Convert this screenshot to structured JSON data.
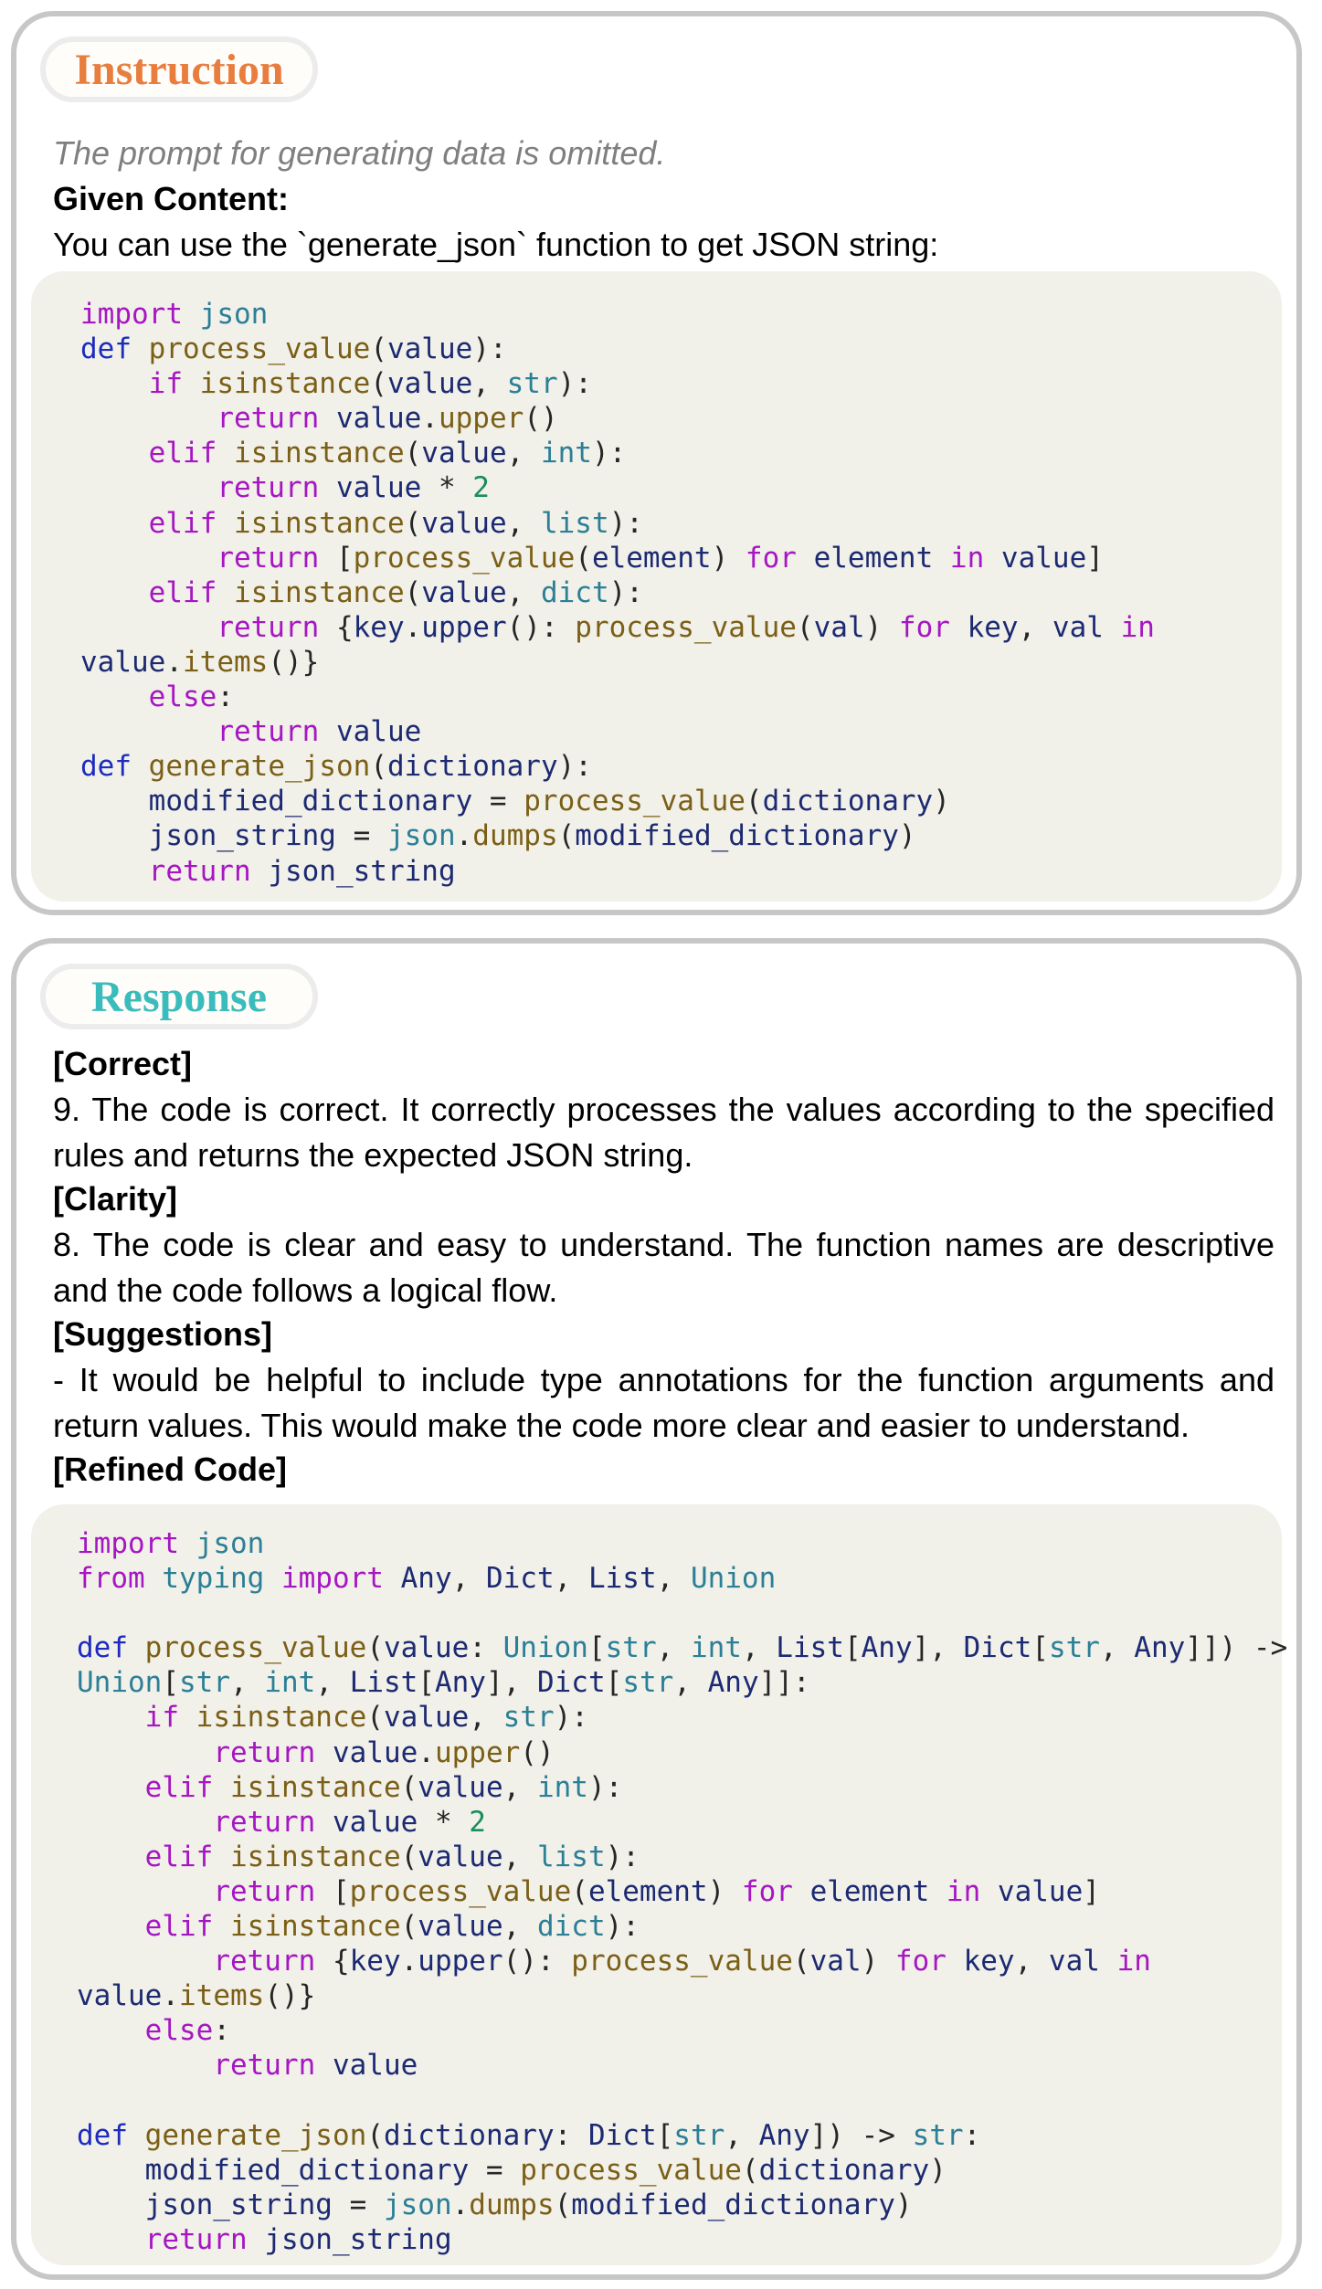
{
  "instruction": {
    "title": "Instruction",
    "note": "The prompt for generating data is omitted.",
    "given_label": "Given Content:",
    "given_text": "You can use the `generate_json` function to get JSON string:",
    "code": [
      [
        [
          "kw",
          "import"
        ],
        [
          "op",
          " "
        ],
        [
          "bi",
          "json"
        ]
      ],
      [
        [
          "kb",
          "def"
        ],
        [
          "op",
          " "
        ],
        [
          "fn",
          "process_value"
        ],
        [
          "op",
          "("
        ],
        [
          "id",
          "value"
        ],
        [
          "op",
          "):"
        ]
      ],
      [
        [
          "op",
          "    "
        ],
        [
          "kw",
          "if"
        ],
        [
          "op",
          " "
        ],
        [
          "fn",
          "isinstance"
        ],
        [
          "op",
          "("
        ],
        [
          "id",
          "value"
        ],
        [
          "op",
          ", "
        ],
        [
          "bi",
          "str"
        ],
        [
          "op",
          "):"
        ]
      ],
      [
        [
          "op",
          "        "
        ],
        [
          "kw",
          "return"
        ],
        [
          "op",
          " "
        ],
        [
          "id",
          "value"
        ],
        [
          "op",
          "."
        ],
        [
          "fn",
          "upper"
        ],
        [
          "op",
          "()"
        ]
      ],
      [
        [
          "op",
          "    "
        ],
        [
          "kw",
          "elif"
        ],
        [
          "op",
          " "
        ],
        [
          "fn",
          "isinstance"
        ],
        [
          "op",
          "("
        ],
        [
          "id",
          "value"
        ],
        [
          "op",
          ", "
        ],
        [
          "bi",
          "int"
        ],
        [
          "op",
          "):"
        ]
      ],
      [
        [
          "op",
          "        "
        ],
        [
          "kw",
          "return"
        ],
        [
          "op",
          " "
        ],
        [
          "id",
          "value"
        ],
        [
          "op",
          " * "
        ],
        [
          "nm",
          "2"
        ]
      ],
      [
        [
          "op",
          "    "
        ],
        [
          "kw",
          "elif"
        ],
        [
          "op",
          " "
        ],
        [
          "fn",
          "isinstance"
        ],
        [
          "op",
          "("
        ],
        [
          "id",
          "value"
        ],
        [
          "op",
          ", "
        ],
        [
          "bi",
          "list"
        ],
        [
          "op",
          "):"
        ]
      ],
      [
        [
          "op",
          "        "
        ],
        [
          "kw",
          "return"
        ],
        [
          "op",
          " ["
        ],
        [
          "fn",
          "process_value"
        ],
        [
          "op",
          "("
        ],
        [
          "id",
          "element"
        ],
        [
          "op",
          ") "
        ],
        [
          "kw",
          "for"
        ],
        [
          "op",
          " "
        ],
        [
          "id",
          "element"
        ],
        [
          "op",
          " "
        ],
        [
          "kw",
          "in"
        ],
        [
          "op",
          " "
        ],
        [
          "id",
          "value"
        ],
        [
          "op",
          "]"
        ]
      ],
      [
        [
          "op",
          "    "
        ],
        [
          "kw",
          "elif"
        ],
        [
          "op",
          " "
        ],
        [
          "fn",
          "isinstance"
        ],
        [
          "op",
          "("
        ],
        [
          "id",
          "value"
        ],
        [
          "op",
          ", "
        ],
        [
          "bi",
          "dict"
        ],
        [
          "op",
          "):"
        ]
      ],
      [
        [
          "op",
          "        "
        ],
        [
          "kw",
          "return"
        ],
        [
          "op",
          " {"
        ],
        [
          "id",
          "key"
        ],
        [
          "op",
          "."
        ],
        [
          "id",
          "upper"
        ],
        [
          "op",
          "(): "
        ],
        [
          "fn",
          "process_value"
        ],
        [
          "op",
          "("
        ],
        [
          "id",
          "val"
        ],
        [
          "op",
          ") "
        ],
        [
          "kw",
          "for"
        ],
        [
          "op",
          " "
        ],
        [
          "id",
          "key"
        ],
        [
          "op",
          ", "
        ],
        [
          "id",
          "val"
        ],
        [
          "op",
          " "
        ],
        [
          "kw",
          "in"
        ]
      ],
      [
        [
          "id",
          "value"
        ],
        [
          "op",
          "."
        ],
        [
          "fn",
          "items"
        ],
        [
          "op",
          "()}"
        ]
      ],
      [
        [
          "op",
          "    "
        ],
        [
          "kw",
          "else"
        ],
        [
          "op",
          ":"
        ]
      ],
      [
        [
          "op",
          "        "
        ],
        [
          "kw",
          "return"
        ],
        [
          "op",
          " "
        ],
        [
          "id",
          "value"
        ]
      ],
      [
        [
          "kb",
          "def"
        ],
        [
          "op",
          " "
        ],
        [
          "fn",
          "generate_json"
        ],
        [
          "op",
          "("
        ],
        [
          "id",
          "dictionary"
        ],
        [
          "op",
          "):"
        ]
      ],
      [
        [
          "op",
          "    "
        ],
        [
          "id",
          "modified_dictionary"
        ],
        [
          "op",
          " = "
        ],
        [
          "fn",
          "process_value"
        ],
        [
          "op",
          "("
        ],
        [
          "id",
          "dictionary"
        ],
        [
          "op",
          ")"
        ]
      ],
      [
        [
          "op",
          "    "
        ],
        [
          "id",
          "json_string"
        ],
        [
          "op",
          " = "
        ],
        [
          "bi",
          "json"
        ],
        [
          "op",
          "."
        ],
        [
          "fn",
          "dumps"
        ],
        [
          "op",
          "("
        ],
        [
          "id",
          "modified_dictionary"
        ],
        [
          "op",
          ")"
        ]
      ],
      [
        [
          "op",
          "    "
        ],
        [
          "kw",
          "return"
        ],
        [
          "op",
          " "
        ],
        [
          "id",
          "json_string"
        ]
      ]
    ]
  },
  "response": {
    "title": "Response",
    "correct_label": "[Correct]",
    "correct_text": "9. The code is correct. It correctly processes the values according to the specified rules and returns the expected JSON string.",
    "clarity_label": "[Clarity]",
    "clarity_text": "8. The code is clear and easy to understand. The function names are descriptive and the code follows a logical flow.",
    "suggestions_label": "[Suggestions]",
    "suggestions_text": "- It would be helpful to include type annotations for the function arguments and return values. This would make the code more clear and easier to understand.",
    "refined_label": "[Refined Code]",
    "code": [
      [
        [
          "kw",
          "import"
        ],
        [
          "op",
          " "
        ],
        [
          "bi",
          "json"
        ]
      ],
      [
        [
          "kw",
          "from"
        ],
        [
          "op",
          " "
        ],
        [
          "bi",
          "typing"
        ],
        [
          "op",
          " "
        ],
        [
          "kw",
          "import"
        ],
        [
          "op",
          " "
        ],
        [
          "id",
          "Any"
        ],
        [
          "op",
          ", "
        ],
        [
          "id",
          "Dict"
        ],
        [
          "op",
          ", "
        ],
        [
          "id",
          "List"
        ],
        [
          "op",
          ", "
        ],
        [
          "bi",
          "Union"
        ]
      ],
      [],
      [
        [
          "kb",
          "def"
        ],
        [
          "op",
          " "
        ],
        [
          "fn",
          "process_value"
        ],
        [
          "op",
          "("
        ],
        [
          "id",
          "value"
        ],
        [
          "op",
          ": "
        ],
        [
          "bi",
          "Union"
        ],
        [
          "op",
          "["
        ],
        [
          "bi",
          "str"
        ],
        [
          "op",
          ", "
        ],
        [
          "bi",
          "int"
        ],
        [
          "op",
          ", "
        ],
        [
          "id",
          "List"
        ],
        [
          "op",
          "["
        ],
        [
          "id",
          "Any"
        ],
        [
          "op",
          "], "
        ],
        [
          "id",
          "Dict"
        ],
        [
          "op",
          "["
        ],
        [
          "bi",
          "str"
        ],
        [
          "op",
          ", "
        ],
        [
          "id",
          "Any"
        ],
        [
          "op",
          "]]) ->"
        ]
      ],
      [
        [
          "bi",
          "Union"
        ],
        [
          "op",
          "["
        ],
        [
          "bi",
          "str"
        ],
        [
          "op",
          ", "
        ],
        [
          "bi",
          "int"
        ],
        [
          "op",
          ", "
        ],
        [
          "id",
          "List"
        ],
        [
          "op",
          "["
        ],
        [
          "id",
          "Any"
        ],
        [
          "op",
          "], "
        ],
        [
          "id",
          "Dict"
        ],
        [
          "op",
          "["
        ],
        [
          "bi",
          "str"
        ],
        [
          "op",
          ", "
        ],
        [
          "id",
          "Any"
        ],
        [
          "op",
          "]]:"
        ]
      ],
      [
        [
          "op",
          "    "
        ],
        [
          "kw",
          "if"
        ],
        [
          "op",
          " "
        ],
        [
          "fn",
          "isinstance"
        ],
        [
          "op",
          "("
        ],
        [
          "id",
          "value"
        ],
        [
          "op",
          ", "
        ],
        [
          "bi",
          "str"
        ],
        [
          "op",
          "):"
        ]
      ],
      [
        [
          "op",
          "        "
        ],
        [
          "kw",
          "return"
        ],
        [
          "op",
          " "
        ],
        [
          "id",
          "value"
        ],
        [
          "op",
          "."
        ],
        [
          "fn",
          "upper"
        ],
        [
          "op",
          "()"
        ]
      ],
      [
        [
          "op",
          "    "
        ],
        [
          "kw",
          "elif"
        ],
        [
          "op",
          " "
        ],
        [
          "fn",
          "isinstance"
        ],
        [
          "op",
          "("
        ],
        [
          "id",
          "value"
        ],
        [
          "op",
          ", "
        ],
        [
          "bi",
          "int"
        ],
        [
          "op",
          "):"
        ]
      ],
      [
        [
          "op",
          "        "
        ],
        [
          "kw",
          "return"
        ],
        [
          "op",
          " "
        ],
        [
          "id",
          "value"
        ],
        [
          "op",
          " * "
        ],
        [
          "nm",
          "2"
        ]
      ],
      [
        [
          "op",
          "    "
        ],
        [
          "kw",
          "elif"
        ],
        [
          "op",
          " "
        ],
        [
          "fn",
          "isinstance"
        ],
        [
          "op",
          "("
        ],
        [
          "id",
          "value"
        ],
        [
          "op",
          ", "
        ],
        [
          "bi",
          "list"
        ],
        [
          "op",
          "):"
        ]
      ],
      [
        [
          "op",
          "        "
        ],
        [
          "kw",
          "return"
        ],
        [
          "op",
          " ["
        ],
        [
          "fn",
          "process_value"
        ],
        [
          "op",
          "("
        ],
        [
          "id",
          "element"
        ],
        [
          "op",
          ") "
        ],
        [
          "kw",
          "for"
        ],
        [
          "op",
          " "
        ],
        [
          "id",
          "element"
        ],
        [
          "op",
          " "
        ],
        [
          "kw",
          "in"
        ],
        [
          "op",
          " "
        ],
        [
          "id",
          "value"
        ],
        [
          "op",
          "]"
        ]
      ],
      [
        [
          "op",
          "    "
        ],
        [
          "kw",
          "elif"
        ],
        [
          "op",
          " "
        ],
        [
          "fn",
          "isinstance"
        ],
        [
          "op",
          "("
        ],
        [
          "id",
          "value"
        ],
        [
          "op",
          ", "
        ],
        [
          "bi",
          "dict"
        ],
        [
          "op",
          "):"
        ]
      ],
      [
        [
          "op",
          "        "
        ],
        [
          "kw",
          "return"
        ],
        [
          "op",
          " {"
        ],
        [
          "id",
          "key"
        ],
        [
          "op",
          "."
        ],
        [
          "id",
          "upper"
        ],
        [
          "op",
          "(): "
        ],
        [
          "fn",
          "process_value"
        ],
        [
          "op",
          "("
        ],
        [
          "id",
          "val"
        ],
        [
          "op",
          ") "
        ],
        [
          "kw",
          "for"
        ],
        [
          "op",
          " "
        ],
        [
          "id",
          "key"
        ],
        [
          "op",
          ", "
        ],
        [
          "id",
          "val"
        ],
        [
          "op",
          " "
        ],
        [
          "kw",
          "in"
        ]
      ],
      [
        [
          "id",
          "value"
        ],
        [
          "op",
          "."
        ],
        [
          "fn",
          "items"
        ],
        [
          "op",
          "()}"
        ]
      ],
      [
        [
          "op",
          "    "
        ],
        [
          "kw",
          "else"
        ],
        [
          "op",
          ":"
        ]
      ],
      [
        [
          "op",
          "        "
        ],
        [
          "kw",
          "return"
        ],
        [
          "op",
          " "
        ],
        [
          "id",
          "value"
        ]
      ],
      [],
      [
        [
          "kb",
          "def"
        ],
        [
          "op",
          " "
        ],
        [
          "fn",
          "generate_json"
        ],
        [
          "op",
          "("
        ],
        [
          "id",
          "dictionary"
        ],
        [
          "op",
          ": "
        ],
        [
          "id",
          "Dict"
        ],
        [
          "op",
          "["
        ],
        [
          "bi",
          "str"
        ],
        [
          "op",
          ", "
        ],
        [
          "id",
          "Any"
        ],
        [
          "op",
          "]) -> "
        ],
        [
          "bi",
          "str"
        ],
        [
          "op",
          ":"
        ]
      ],
      [
        [
          "op",
          "    "
        ],
        [
          "id",
          "modified_dictionary"
        ],
        [
          "op",
          " = "
        ],
        [
          "fn",
          "process_value"
        ],
        [
          "op",
          "("
        ],
        [
          "id",
          "dictionary"
        ],
        [
          "op",
          ")"
        ]
      ],
      [
        [
          "op",
          "    "
        ],
        [
          "id",
          "json_string"
        ],
        [
          "op",
          " = "
        ],
        [
          "bi",
          "json"
        ],
        [
          "op",
          "."
        ],
        [
          "fn",
          "dumps"
        ],
        [
          "op",
          "("
        ],
        [
          "id",
          "modified_dictionary"
        ],
        [
          "op",
          ")"
        ]
      ],
      [
        [
          "op",
          "    "
        ],
        [
          "kw",
          "return"
        ],
        [
          "op",
          " "
        ],
        [
          "id",
          "json_string"
        ]
      ]
    ]
  }
}
